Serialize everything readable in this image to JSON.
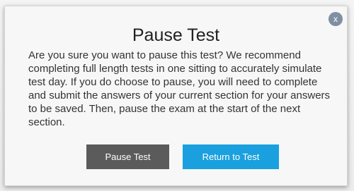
{
  "dialog": {
    "title": "Pause Test",
    "message": "Are you sure you want to pause this test? We recommend completing full length tests in one sitting to accurately simulate test day. If you do choose to pause, you will need to complete and submit the answers of your current section for your answers to be saved. Then, pause the exam at the start of the next section.",
    "close_glyph": "x",
    "close_icon": "close-icon",
    "buttons": {
      "pause_label": "Pause Test",
      "return_label": "Return to Test"
    }
  },
  "colors": {
    "pause_button": "#5b5b5b",
    "return_button": "#1aa0de",
    "close_button": "#7f8fa3"
  }
}
